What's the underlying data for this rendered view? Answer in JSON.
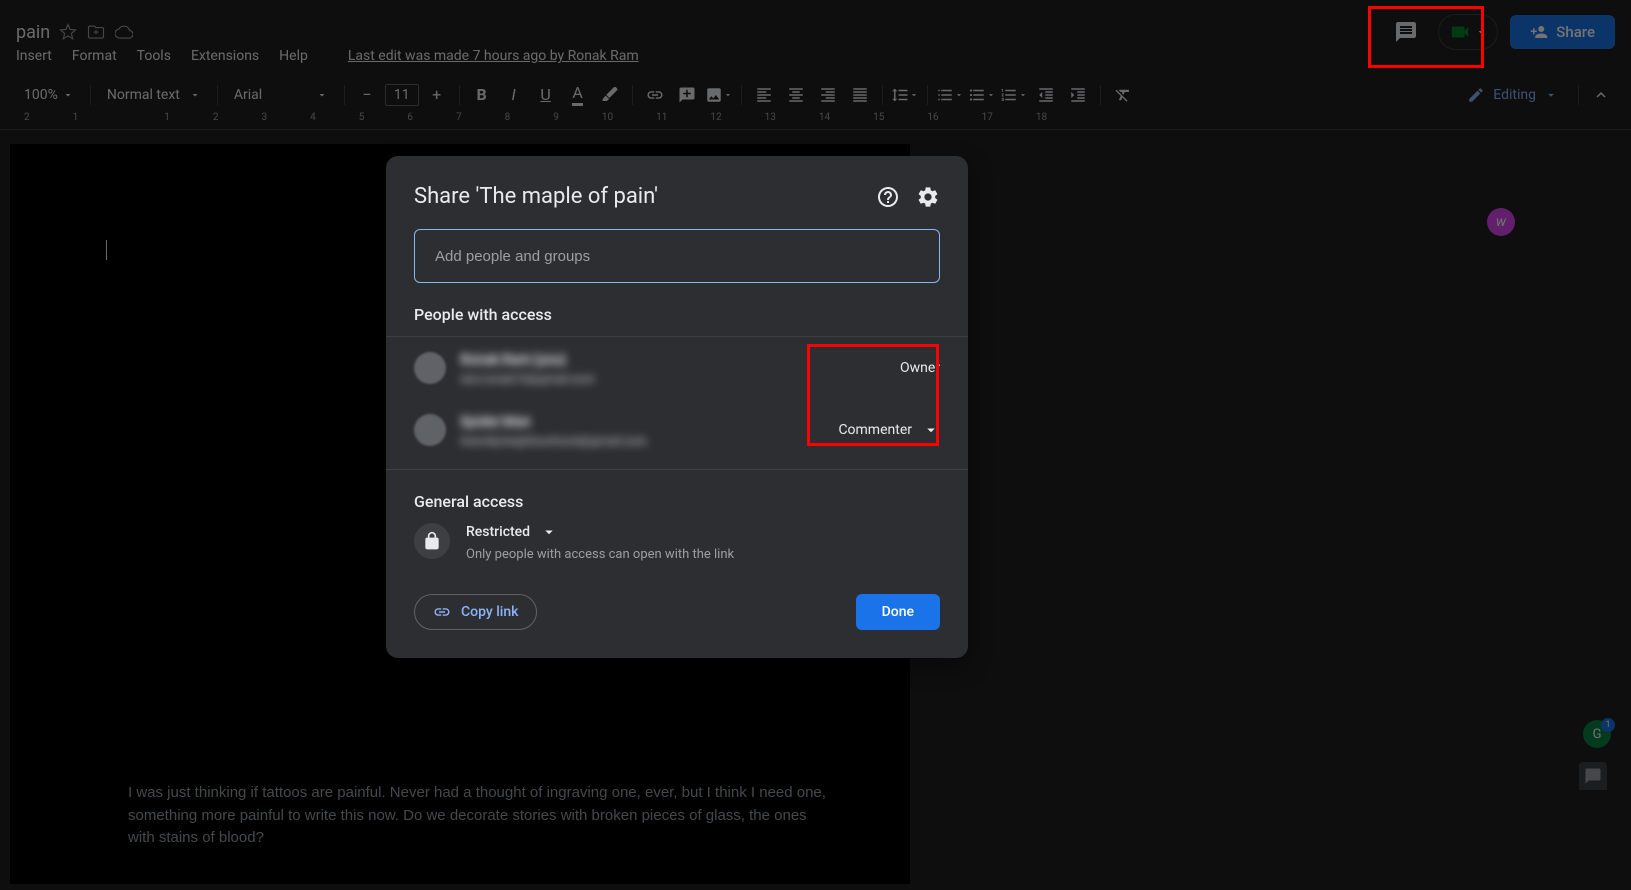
{
  "doc": {
    "title_suffix": "pain",
    "body_text": "I was just thinking if tattoos are painful. Never had a thought of ingraving one, ever, but I think I need one, something more painful to write this now. Do we decorate stories with broken pieces of glass, the ones with stains of blood?"
  },
  "menus": {
    "insert": "Insert",
    "format": "Format",
    "tools": "Tools",
    "extensions": "Extensions",
    "help": "Help",
    "last_edit": "Last edit was made 7 hours ago by Ronak Ram"
  },
  "header": {
    "share_label": "Share"
  },
  "toolbar": {
    "zoom": "100%",
    "style": "Normal text",
    "font": "Arial",
    "font_size": "11",
    "mode": "Editing"
  },
  "ruler": [
    "2",
    "1",
    "",
    "1",
    "2",
    "3",
    "4",
    "5",
    "6",
    "7",
    "8",
    "9",
    "10",
    "11",
    "12",
    "13",
    "14",
    "15",
    "16",
    "17",
    "18"
  ],
  "modal": {
    "title": "Share 'The maple of pain'",
    "input_placeholder": "Add people and groups",
    "people_heading": "People with access",
    "people": [
      {
        "name": "Ronak Ram (you)",
        "email": "ram.ronak19@gmail.com",
        "role": "Owner",
        "has_dropdown": false
      },
      {
        "name": "Spider Man",
        "email": "friendlyneighbourhood@gmail.com",
        "role": "Commenter",
        "has_dropdown": true
      }
    ],
    "general_heading": "General access",
    "access_level": "Restricted",
    "access_desc": "Only people with access can open with the link",
    "copy_link": "Copy link",
    "done": "Done"
  },
  "badges": {
    "side": "w",
    "gram": "G",
    "gram_count": "1"
  }
}
